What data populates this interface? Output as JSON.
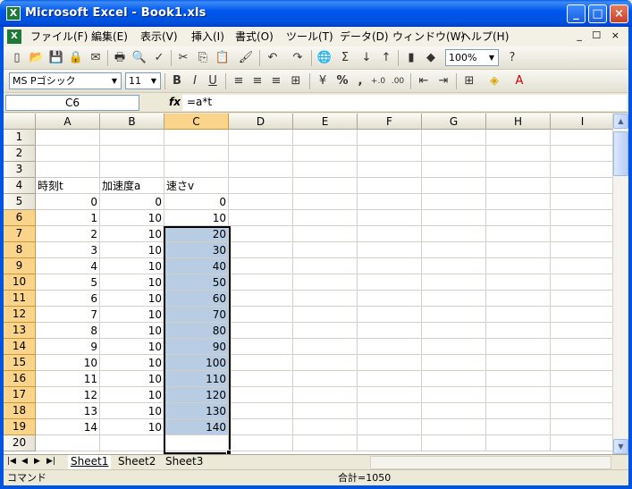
{
  "window": {
    "title": "Microsoft Excel - Book1.xls"
  },
  "menu": {
    "items": [
      "ファイル(F)",
      "編集(E)",
      "表示(V)",
      "挿入(I)",
      "書式(O)",
      "ツール(T)",
      "データ(D)",
      "ウィンドウ(W)",
      "ヘルプ(H)"
    ],
    "window_controls": "_ ☐ ×"
  },
  "toolbar": {
    "zoom": "100%",
    "font_name": "MS Pゴシック",
    "font_size": "11",
    "bold": "B",
    "italic": "I",
    "underline": "U",
    "percent": "%",
    "comma": ",",
    "sum": "Σ"
  },
  "formula_bar": {
    "name_box": "C6",
    "fx": "fx",
    "formula": "=a*t"
  },
  "columns": [
    "A",
    "B",
    "C",
    "D",
    "E",
    "F",
    "G",
    "H",
    "I"
  ],
  "rows": [
    "1",
    "2",
    "3",
    "4",
    "5",
    "6",
    "7",
    "8",
    "9",
    "10",
    "11",
    "12",
    "13",
    "14",
    "15",
    "16",
    "17",
    "18",
    "19",
    "20"
  ],
  "headers": {
    "a": "時刻t",
    "b": "加速度a",
    "c": "速さv"
  },
  "data": [
    {
      "t": "0",
      "a": "0",
      "v": "0"
    },
    {
      "t": "1",
      "a": "10",
      "v": "10"
    },
    {
      "t": "2",
      "a": "10",
      "v": "20"
    },
    {
      "t": "3",
      "a": "10",
      "v": "30"
    },
    {
      "t": "4",
      "a": "10",
      "v": "40"
    },
    {
      "t": "5",
      "a": "10",
      "v": "50"
    },
    {
      "t": "6",
      "a": "10",
      "v": "60"
    },
    {
      "t": "7",
      "a": "10",
      "v": "70"
    },
    {
      "t": "8",
      "a": "10",
      "v": "80"
    },
    {
      "t": "9",
      "a": "10",
      "v": "90"
    },
    {
      "t": "10",
      "a": "10",
      "v": "100"
    },
    {
      "t": "11",
      "a": "10",
      "v": "110"
    },
    {
      "t": "12",
      "a": "10",
      "v": "120"
    },
    {
      "t": "13",
      "a": "10",
      "v": "130"
    },
    {
      "t": "14",
      "a": "10",
      "v": "140"
    }
  ],
  "sheets": [
    "Sheet1",
    "Sheet2",
    "Sheet3"
  ],
  "status": {
    "mode": "コマンド",
    "sum": "合計=1050"
  },
  "colors": {
    "selection": "#b8cce4",
    "header_selected": "#f9d48a",
    "title_bar": "#0054e3"
  }
}
